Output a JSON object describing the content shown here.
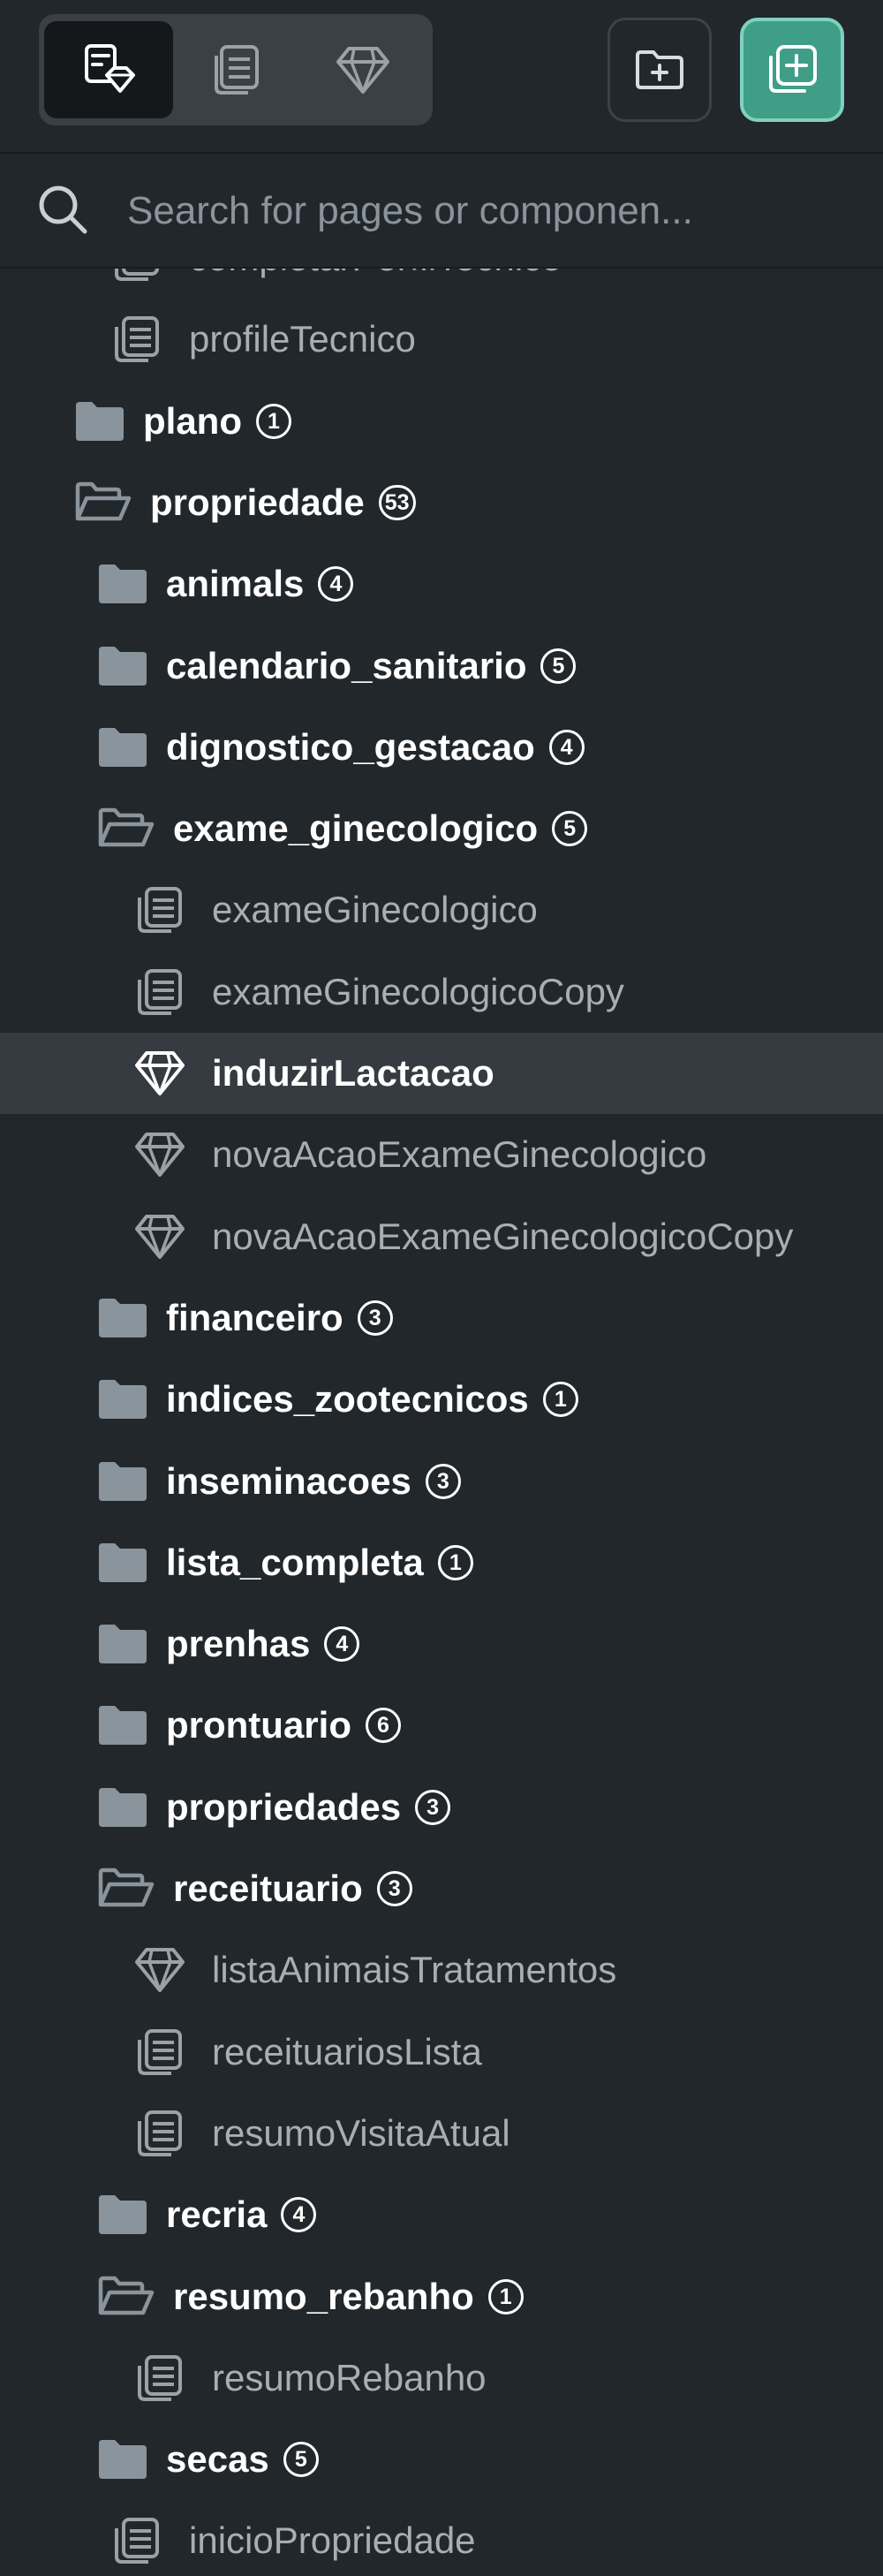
{
  "toolbar": {
    "tabs": [
      {
        "icon": "page-widget-icon",
        "active": true
      },
      {
        "icon": "pages-stack-icon",
        "active": false
      },
      {
        "icon": "gem-icon",
        "active": false
      }
    ],
    "buttons": [
      {
        "icon": "folder-plus-icon"
      },
      {
        "icon": "add-page-icon",
        "accent": "#3f9e88"
      }
    ]
  },
  "search": {
    "placeholder": "Search for pages or componen..."
  },
  "tree": {
    "items": [
      {
        "type": "page",
        "icon": "pages-icon",
        "label": "completarPerfilTecnico"
      },
      {
        "type": "page",
        "icon": "pages-icon",
        "label": "profileTecnico"
      },
      {
        "type": "folder",
        "open": false,
        "label": "plano",
        "count": "1"
      },
      {
        "type": "folder",
        "open": true,
        "label": "propriedade",
        "count": "53"
      },
      {
        "type": "folder",
        "open": false,
        "label": "animals",
        "count": "4"
      },
      {
        "type": "folder",
        "open": false,
        "label": "calendario_sanitario",
        "count": "5"
      },
      {
        "type": "folder",
        "open": false,
        "label": "dignostico_gestacao",
        "count": "4"
      },
      {
        "type": "folder",
        "open": true,
        "label": "exame_ginecologico",
        "count": "5"
      },
      {
        "type": "page",
        "icon": "pages-icon",
        "label": "exameGinecologico"
      },
      {
        "type": "page",
        "icon": "pages-icon",
        "label": "exameGinecologicoCopy"
      },
      {
        "type": "component",
        "icon": "gem-icon",
        "label": "induzirLactacao",
        "selected": true
      },
      {
        "type": "component",
        "icon": "gem-icon",
        "label": "novaAcaoExameGinecologico"
      },
      {
        "type": "component",
        "icon": "gem-icon",
        "label": "novaAcaoExameGinecologicoCopy"
      },
      {
        "type": "folder",
        "open": false,
        "label": "financeiro",
        "count": "3"
      },
      {
        "type": "folder",
        "open": false,
        "label": "indices_zootecnicos",
        "count": "1"
      },
      {
        "type": "folder",
        "open": false,
        "label": "inseminacoes",
        "count": "3"
      },
      {
        "type": "folder",
        "open": false,
        "label": "lista_completa",
        "count": "1"
      },
      {
        "type": "folder",
        "open": false,
        "label": "prenhas",
        "count": "4"
      },
      {
        "type": "folder",
        "open": false,
        "label": "prontuario",
        "count": "6"
      },
      {
        "type": "folder",
        "open": false,
        "label": "propriedades",
        "count": "3"
      },
      {
        "type": "folder",
        "open": true,
        "label": "receituario",
        "count": "3"
      },
      {
        "type": "component",
        "icon": "gem-icon",
        "label": "listaAnimaisTratamentos"
      },
      {
        "type": "page",
        "icon": "pages-icon",
        "label": "receituariosLista"
      },
      {
        "type": "page",
        "icon": "pages-icon",
        "label": "resumoVisitaAtual"
      },
      {
        "type": "folder",
        "open": false,
        "label": "recria",
        "count": "4"
      },
      {
        "type": "folder",
        "open": true,
        "label": "resumo_rebanho",
        "count": "1"
      },
      {
        "type": "page",
        "icon": "pages-icon",
        "label": "resumoRebanho"
      },
      {
        "type": "folder",
        "open": false,
        "label": "secas",
        "count": "5"
      },
      {
        "type": "page",
        "icon": "pages-icon",
        "label": "inicioPropriedade"
      }
    ]
  },
  "colors": {
    "background": "#22272b",
    "selected_row": "#353b40",
    "accent": "#3f9e88",
    "folder_icon": "#8a949c",
    "page_text": "#a7aeb4"
  }
}
